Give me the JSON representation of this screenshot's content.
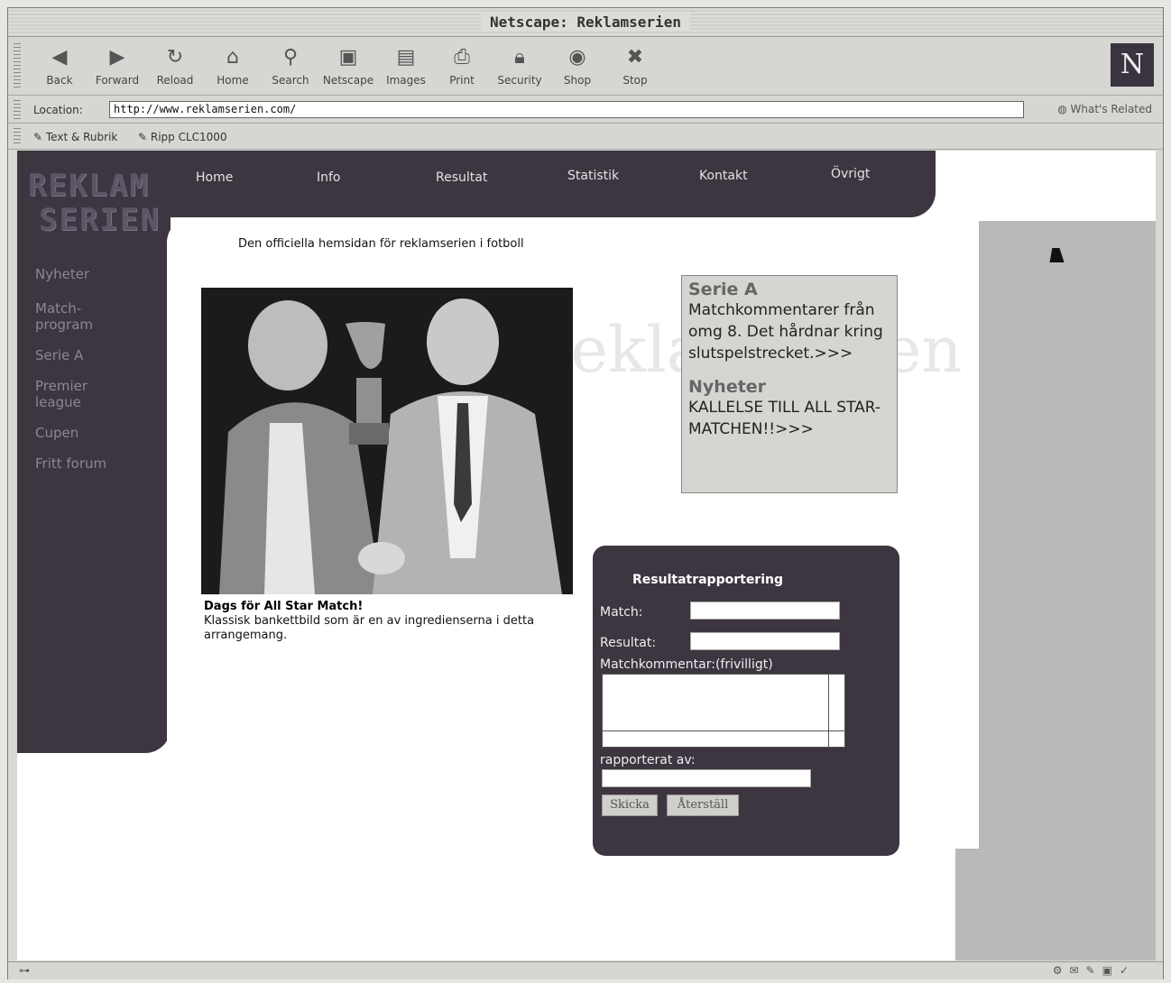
{
  "window": {
    "title": "Netscape: Reklamserien"
  },
  "toolbar": {
    "buttons": [
      {
        "label": "Back",
        "icon": "back-arrow-icon"
      },
      {
        "label": "Forward",
        "icon": "forward-arrow-icon"
      },
      {
        "label": "Reload",
        "icon": "reload-icon"
      },
      {
        "label": "Home",
        "icon": "home-icon"
      },
      {
        "label": "Search",
        "icon": "search-icon"
      },
      {
        "label": "Netscape",
        "icon": "my-netscape-icon"
      },
      {
        "label": "Images",
        "icon": "images-icon"
      },
      {
        "label": "Print",
        "icon": "print-icon"
      },
      {
        "label": "Security",
        "icon": "security-lock-icon"
      },
      {
        "label": "Shop",
        "icon": "shop-icon"
      },
      {
        "label": "Stop",
        "icon": "stop-icon"
      }
    ],
    "logo_letter": "N"
  },
  "location": {
    "label": "Location:",
    "url": "http://www.reklamserien.com/",
    "related": "What's Related"
  },
  "personal": {
    "items": [
      "Text & Rubrik",
      "Ripp CLC1000"
    ]
  },
  "site": {
    "logo_line1": "REKLAM",
    "logo_line2": "SERIEN",
    "nav": [
      "Home",
      "Info",
      "Resultat",
      "Statistik",
      "Kontakt",
      "Övrigt"
    ],
    "sidebar": [
      "Nyheter",
      "Match-\nprogram",
      "Serie A",
      "Premier\nleague",
      "Cupen",
      "Fritt forum"
    ],
    "subtitle": "Den officiella hemsidan för reklamserien i fotboll",
    "caption_title": "Dags för All Star Match!",
    "caption_text": "Klassisk bankettbild som är en av ingredienserna i detta arrangemang.",
    "news": [
      {
        "heading": "Serie A",
        "text": "Matchkommentarer från omg 8. Det hårdnar kring slutspelstrecket.>>>"
      },
      {
        "heading": "Nyheter",
        "text": "KALLELSE TILL ALL STAR-MATCHEN!!>>>"
      }
    ],
    "form": {
      "title": "Resultatrapportering",
      "match_label": "Match:",
      "result_label": "Resultat:",
      "comment_label": "Matchkommentar:(frivilligt)",
      "reporter_label": "rapporterat av:",
      "submit": "Skicka",
      "reset": "Återställ"
    },
    "watermark": "reklamserien"
  }
}
